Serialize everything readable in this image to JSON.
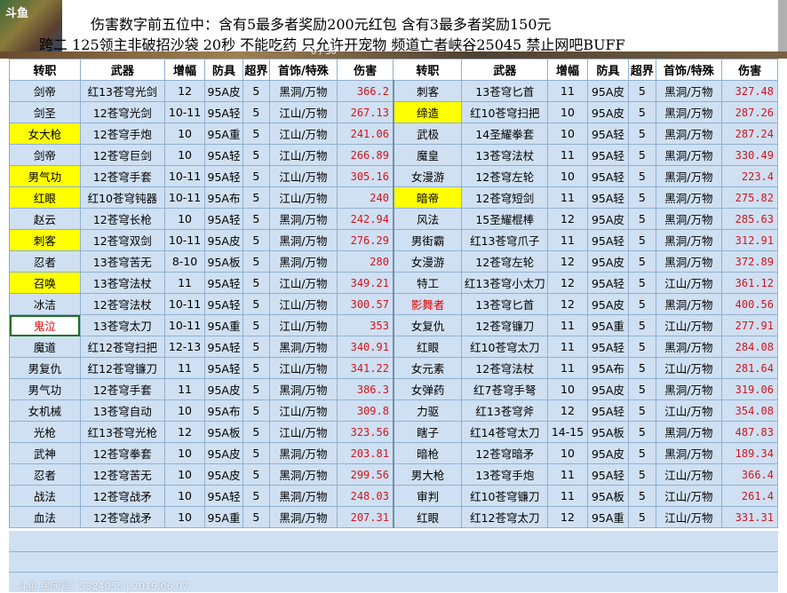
{
  "banner": {
    "line1": "伤害数字前五位中：含有5最多者奖励200元红包  含有3最多者奖励150元",
    "line2": "跨二 125领主非破招沙袋 20秒 不能吃药 只允许开宠物 频道亡者峡谷25045 禁止网吧BUFF",
    "logo": "斗鱼",
    "counter": "0 / 30"
  },
  "headers": [
    "转职",
    "武器",
    "增幅",
    "防具",
    "超界",
    "首饰/特殊",
    "伤害",
    "转职",
    "武器",
    "增幅",
    "防具",
    "超界",
    "首饰/特殊",
    "伤害"
  ],
  "rows": [
    [
      [
        "剑帝",
        ""
      ],
      "红13苍穹光剑",
      "12",
      "95A皮",
      "5",
      "黑洞/万物",
      "366.2",
      [
        "刺客",
        ""
      ],
      "13苍穹匕首",
      "11",
      "95A皮",
      "5",
      "黑洞/万物",
      "327.48"
    ],
    [
      [
        "剑圣",
        ""
      ],
      "12苍穹光剑",
      "10-11",
      "95A轻",
      "5",
      "江山/万物",
      "267.13",
      [
        "缔造",
        "hl"
      ],
      "红10苍穹扫把",
      "10",
      "95A皮",
      "5",
      "黑洞/万物",
      "287.26"
    ],
    [
      [
        "女大枪",
        "hl"
      ],
      "12苍穹手炮",
      "10",
      "95A重",
      "5",
      "江山/万物",
      "241.06",
      [
        "武极",
        ""
      ],
      "14圣耀拳套",
      "10",
      "95A轻",
      "5",
      "黑洞/万物",
      "287.24"
    ],
    [
      [
        "剑帝",
        ""
      ],
      "12苍穹巨剑",
      "10",
      "95A轻",
      "5",
      "江山/万物",
      "266.89",
      [
        "魔皇",
        ""
      ],
      "13苍穹法杖",
      "11",
      "95A轻",
      "5",
      "黑洞/万物",
      "330.49"
    ],
    [
      [
        "男气功",
        "hl"
      ],
      "12苍穹手套",
      "10-11",
      "95A轻",
      "5",
      "江山/万物",
      "305.16",
      [
        "女漫游",
        ""
      ],
      "12苍穹左轮",
      "10",
      "95A轻",
      "5",
      "黑洞/万物",
      "223.4"
    ],
    [
      [
        "红眼",
        "hl"
      ],
      "红10苍穹钝器",
      "10-11",
      "95A布",
      "5",
      "江山/万物",
      "240",
      [
        "暗帝",
        "hl"
      ],
      "12苍穹短剑",
      "11",
      "95A轻",
      "5",
      "黑洞/万物",
      "275.82"
    ],
    [
      [
        "赵云",
        ""
      ],
      "12苍穹长枪",
      "10",
      "95A轻",
      "5",
      "黑洞/万物",
      "242.94",
      [
        "风法",
        ""
      ],
      "15圣耀棍棒",
      "12",
      "95A皮",
      "5",
      "黑洞/万物",
      "285.63"
    ],
    [
      [
        "刺客",
        "hl"
      ],
      "12苍穹双剑",
      "10-11",
      "95A皮",
      "5",
      "黑洞/万物",
      "276.29",
      [
        "男街霸",
        ""
      ],
      "红13苍穹爪子",
      "11",
      "95A轻",
      "5",
      "黑洞/万物",
      "312.91"
    ],
    [
      [
        "忍者",
        ""
      ],
      "13苍穹苦无",
      "8-10",
      "95A板",
      "5",
      "黑洞/万物",
      "280",
      [
        "女漫游",
        ""
      ],
      "12苍穹左轮",
      "12",
      "95A皮",
      "5",
      "黑洞/万物",
      "372.89"
    ],
    [
      [
        "召唤",
        "hl"
      ],
      "13苍穹法杖",
      "11",
      "95A轻",
      "5",
      "江山/万物",
      "349.21",
      [
        "特工",
        ""
      ],
      "红13苍穹小太刀",
      "12",
      "95A轻",
      "5",
      "江山/万物",
      "361.12"
    ],
    [
      [
        "冰洁",
        ""
      ],
      "12苍穹法杖",
      "10-11",
      "95A轻",
      "5",
      "江山/万物",
      "300.57",
      [
        "影舞者",
        "red"
      ],
      "13苍穹匕首",
      "12",
      "95A皮",
      "5",
      "黑洞/万物",
      "400.56"
    ],
    [
      [
        "鬼泣",
        "sel"
      ],
      "13苍穹太刀",
      "10-11",
      "95A重",
      "5",
      "江山/万物",
      "353",
      [
        "女复仇",
        ""
      ],
      "12苍穹镰刀",
      "11",
      "95A重",
      "5",
      "江山/万物",
      "277.91"
    ],
    [
      [
        "魔道",
        ""
      ],
      "红12苍穹扫把",
      "12-13",
      "95A轻",
      "5",
      "黑洞/万物",
      "340.91",
      [
        "红眼",
        ""
      ],
      "红10苍穹太刀",
      "11",
      "95A轻",
      "5",
      "黑洞/万物",
      "284.08"
    ],
    [
      [
        "男复仇",
        ""
      ],
      "红12苍穹镰刀",
      "11",
      "95A轻",
      "5",
      "江山/万物",
      "341.22",
      [
        "女元素",
        ""
      ],
      "12苍穹法杖",
      "11",
      "95A布",
      "5",
      "江山/万物",
      "281.64"
    ],
    [
      [
        "男气功",
        ""
      ],
      "12苍穹手套",
      "11",
      "95A皮",
      "5",
      "黑洞/万物",
      "386.3",
      [
        "女弹药",
        ""
      ],
      "红7苍穹手弩",
      "10",
      "95A皮",
      "5",
      "黑洞/万物",
      "319.06"
    ],
    [
      [
        "女机械",
        ""
      ],
      "13苍穹自动",
      "10",
      "95A布",
      "5",
      "江山/万物",
      "309.8",
      [
        "力驱",
        ""
      ],
      "红13苍穹斧",
      "12",
      "95A轻",
      "5",
      "江山/万物",
      "354.08"
    ],
    [
      [
        "光枪",
        ""
      ],
      "红13苍穹光枪",
      "12",
      "95A板",
      "5",
      "江山/万物",
      "323.56",
      [
        "瞎子",
        ""
      ],
      "红14苍穹太刀",
      "14-15",
      "95A板",
      "5",
      "黑洞/万物",
      "487.83"
    ],
    [
      [
        "武神",
        ""
      ],
      "12苍穹拳套",
      "10",
      "95A皮",
      "5",
      "黑洞/万物",
      "203.81",
      [
        "暗枪",
        ""
      ],
      "12苍穹暗矛",
      "10",
      "95A皮",
      "5",
      "黑洞/万物",
      "189.34"
    ],
    [
      [
        "忍者",
        ""
      ],
      "12苍穹苦无",
      "10",
      "95A皮",
      "5",
      "黑洞/万物",
      "299.56",
      [
        "男大枪",
        ""
      ],
      "13苍穹手炮",
      "11",
      "95A轻",
      "5",
      "江山/万物",
      "366.4"
    ],
    [
      [
        "战法",
        ""
      ],
      "12苍穹战矛",
      "10",
      "95A轻",
      "5",
      "黑洞/万物",
      "248.03",
      [
        "审判",
        ""
      ],
      "红10苍穹镰刀",
      "11",
      "95A板",
      "5",
      "江山/万物",
      "261.4"
    ],
    [
      [
        "血法",
        ""
      ],
      "12苍穹战矛",
      "10",
      "95A重",
      "5",
      "黑洞/万物",
      "207.31",
      [
        "红眼",
        ""
      ],
      "红12苍穹太刀",
      "12",
      "95A重",
      "5",
      "江山/万物",
      "331.31"
    ]
  ],
  "watermark": "斗鱼 房间号：5324055 | 2019.06.07"
}
